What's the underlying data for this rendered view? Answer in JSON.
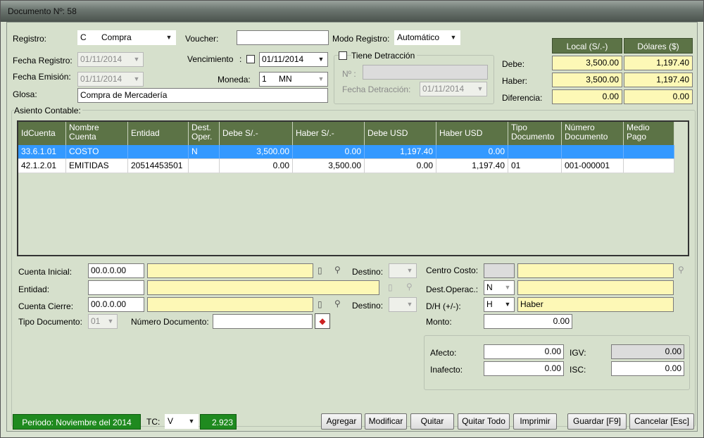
{
  "window": {
    "title": "Documento Nº: 58"
  },
  "header": {
    "registro_label": "Registro:",
    "registro_code": "C",
    "registro_value": "Compra",
    "voucher_label": "Voucher:",
    "voucher_value": "",
    "modo_label": "Modo Registro:",
    "modo_value": "Automático",
    "fecha_registro_label": "Fecha Registro:",
    "fecha_registro_value": "01/11/2014",
    "vencimiento_label": "Vencimiento",
    "vencimiento_sep": ":",
    "vencimiento_value": "01/11/2014",
    "fecha_emision_label": "Fecha Emisión:",
    "fecha_emision_value": "01/11/2014",
    "moneda_label": "Moneda:",
    "moneda_code": "1",
    "moneda_value": "MN",
    "glosa_label": "Glosa:",
    "glosa_value": "Compra de Mercadería",
    "detraccion_label": "Tiene Detracción",
    "detraccion_no_label": "Nº :",
    "detraccion_no_value": "",
    "fecha_detraccion_label": "Fecha Detracción:",
    "fecha_detraccion_value": "01/11/2014"
  },
  "summary": {
    "col_local": "Local (S/.-)",
    "col_usd": "Dólares ($)",
    "rows": [
      {
        "label": "Debe:",
        "local": "3,500.00",
        "usd": "1,197.40"
      },
      {
        "label": "Haber:",
        "local": "3,500.00",
        "usd": "1,197.40"
      },
      {
        "label": "Diferencia:",
        "local": "0.00",
        "usd": "0.00"
      }
    ]
  },
  "asiento": {
    "title": "Asiento Contable:",
    "columns": [
      "IdCuenta",
      "Nombre\nCuenta",
      "Entidad",
      "Dest.\nOper.",
      "Debe S/.-",
      "Haber S/.-",
      "Debe USD",
      "Haber USD",
      "Tipo\nDocumento",
      "Número\nDocumento",
      "Medio\nPago"
    ],
    "rows": [
      [
        "33.6.1.01",
        "COSTO",
        "",
        "N",
        "3,500.00",
        "0.00",
        "1,197.40",
        "0.00",
        "",
        "",
        ""
      ],
      [
        "42.1.2.01",
        "EMITIDAS",
        "20514453501",
        "",
        "0.00",
        "3,500.00",
        "0.00",
        "1,197.40",
        "01",
        "001-000001",
        ""
      ]
    ]
  },
  "detail": {
    "cuenta_inicial_label": "Cuenta Inicial:",
    "cuenta_inicial_value": "00.0.0.00",
    "entidad_label": "Entidad:",
    "entidad_value": "",
    "cuenta_cierre_label": "Cuenta Cierre:",
    "cuenta_cierre_value": "00.0.0.00",
    "tipo_doc_label": "Tipo Documento:",
    "tipo_doc_value": "01",
    "num_doc_label": "Número Documento:",
    "num_doc_value": "",
    "destino_label": "Destino:",
    "centro_costo_label": "Centro Costo:",
    "dest_operac_label": "Dest.Operac.:",
    "dest_operac_value": "N",
    "dh_label": "D/H (+/-):",
    "dh_value": "H",
    "dh_desc": "Haber",
    "monto_label": "Monto:",
    "monto_value": "0.00",
    "afecto_label": "Afecto:",
    "afecto_value": "0.00",
    "inafecto_label": "Inafecto:",
    "inafecto_value": "0.00",
    "igv_label": "IGV:",
    "igv_value": "0.00",
    "isc_label": "ISC:",
    "isc_value": "0.00"
  },
  "footer": {
    "periodo": "Periodo: Noviembre del 2014",
    "tc_label": "TC:",
    "tc_value": "V",
    "tc_rate": "2.923",
    "buttons": [
      "Agregar",
      "Modificar",
      "Quitar",
      "Quitar Todo",
      "Imprimir",
      "Guardar [F9]",
      "Cancelar [Esc]"
    ]
  },
  "icons": {
    "arrow": "▼"
  },
  "colors": {
    "header_green": "#5c7346",
    "yellow_field": "#fdf8b6",
    "selected_row": "#3399ff",
    "period_green": "#1f8a1f"
  }
}
